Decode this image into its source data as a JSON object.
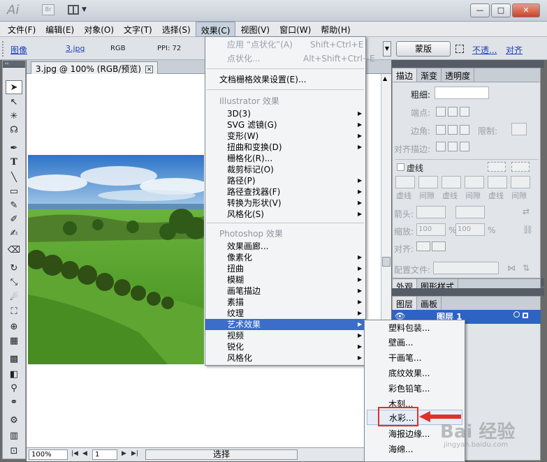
{
  "titlebar": {
    "app_logo": "Ai",
    "bridge_label": "Br",
    "window_buttons": [
      "—",
      "□",
      "✕"
    ]
  },
  "menubar": [
    "文件(F)",
    "编辑(E)",
    "对象(O)",
    "文字(T)",
    "选择(S)",
    "效果(C)",
    "视图(V)",
    "窗口(W)",
    "帮助(H)"
  ],
  "controlbar": {
    "image_link": "图像",
    "file_link": "3.jpg",
    "color_mode": "RGB",
    "ppi": "PPI: 72",
    "mask_button": "蒙版",
    "opacity_link": "不透...",
    "align_link": "对齐"
  },
  "document": {
    "tab_title": "3.jpg @ 100% (RGB/预览)",
    "tab_close": "✕"
  },
  "status": {
    "zoom": "100%",
    "page": "1",
    "selection_mode": "选择"
  },
  "effect_menu": {
    "items_top": [
      {
        "label": "应用 “点状化”(A)",
        "shortcut": "Shift+Ctrl+E",
        "disabled": true
      },
      {
        "label": "点状化...",
        "shortcut": "Alt+Shift+Ctrl+E",
        "disabled": true
      }
    ],
    "raster_settings": "文档栅格效果设置(E)...",
    "illustrator_header": "Illustrator 效果",
    "illustrator_items": [
      "3D(3)",
      "SVG 滤镜(G)",
      "变形(W)",
      "扭曲和变换(D)",
      "栅格化(R)...",
      "裁剪标记(O)",
      "路径(P)",
      "路径查找器(F)",
      "转换为形状(V)",
      "风格化(S)"
    ],
    "photoshop_header": "Photoshop 效果",
    "photoshop_items": [
      "效果画廊...",
      "像素化",
      "扭曲",
      "模糊",
      "画笔描边",
      "素描",
      "纹理",
      "艺术效果",
      "视频",
      "锐化",
      "风格化"
    ],
    "highlighted": "艺术效果"
  },
  "artistic_submenu": [
    "塑料包装...",
    "壁画...",
    "干画笔...",
    "底纹效果...",
    "彩色铅笔...",
    "木刻...",
    "水彩...",
    "海报边缘...",
    "海绵..."
  ],
  "submenu_hover": "水彩...",
  "stroke_panel": {
    "tabs": [
      "描边",
      "渐变",
      "透明度"
    ],
    "weight_label": "粗细:",
    "cap_label": "端点:",
    "corner_label": "边角:",
    "limit_label": "限制:",
    "align_label": "对齐描边:",
    "dashed_label": "虚线",
    "dash_labels": [
      "虚线",
      "间隙",
      "虚线",
      "间隙",
      "虚线",
      "间隙"
    ],
    "arrow_label": "箭头:",
    "scale_label": "缩放:",
    "scale_values": [
      "100",
      "100"
    ],
    "percent": "%",
    "align2_label": "对齐:",
    "profile_label": "配置文件:"
  },
  "appearance_panel": {
    "tabs": [
      "外观",
      "图形样式"
    ]
  },
  "layers_panel": {
    "tabs": [
      "图层",
      "画板"
    ],
    "layer_name": "图层 1"
  },
  "watermark": {
    "text": "Bai 经验",
    "sub": "jingyan.baidu.com"
  },
  "colors": {
    "menu_highlight": "#3b6ec9",
    "red_box": "#e0302a",
    "link": "#1a3fb5"
  }
}
